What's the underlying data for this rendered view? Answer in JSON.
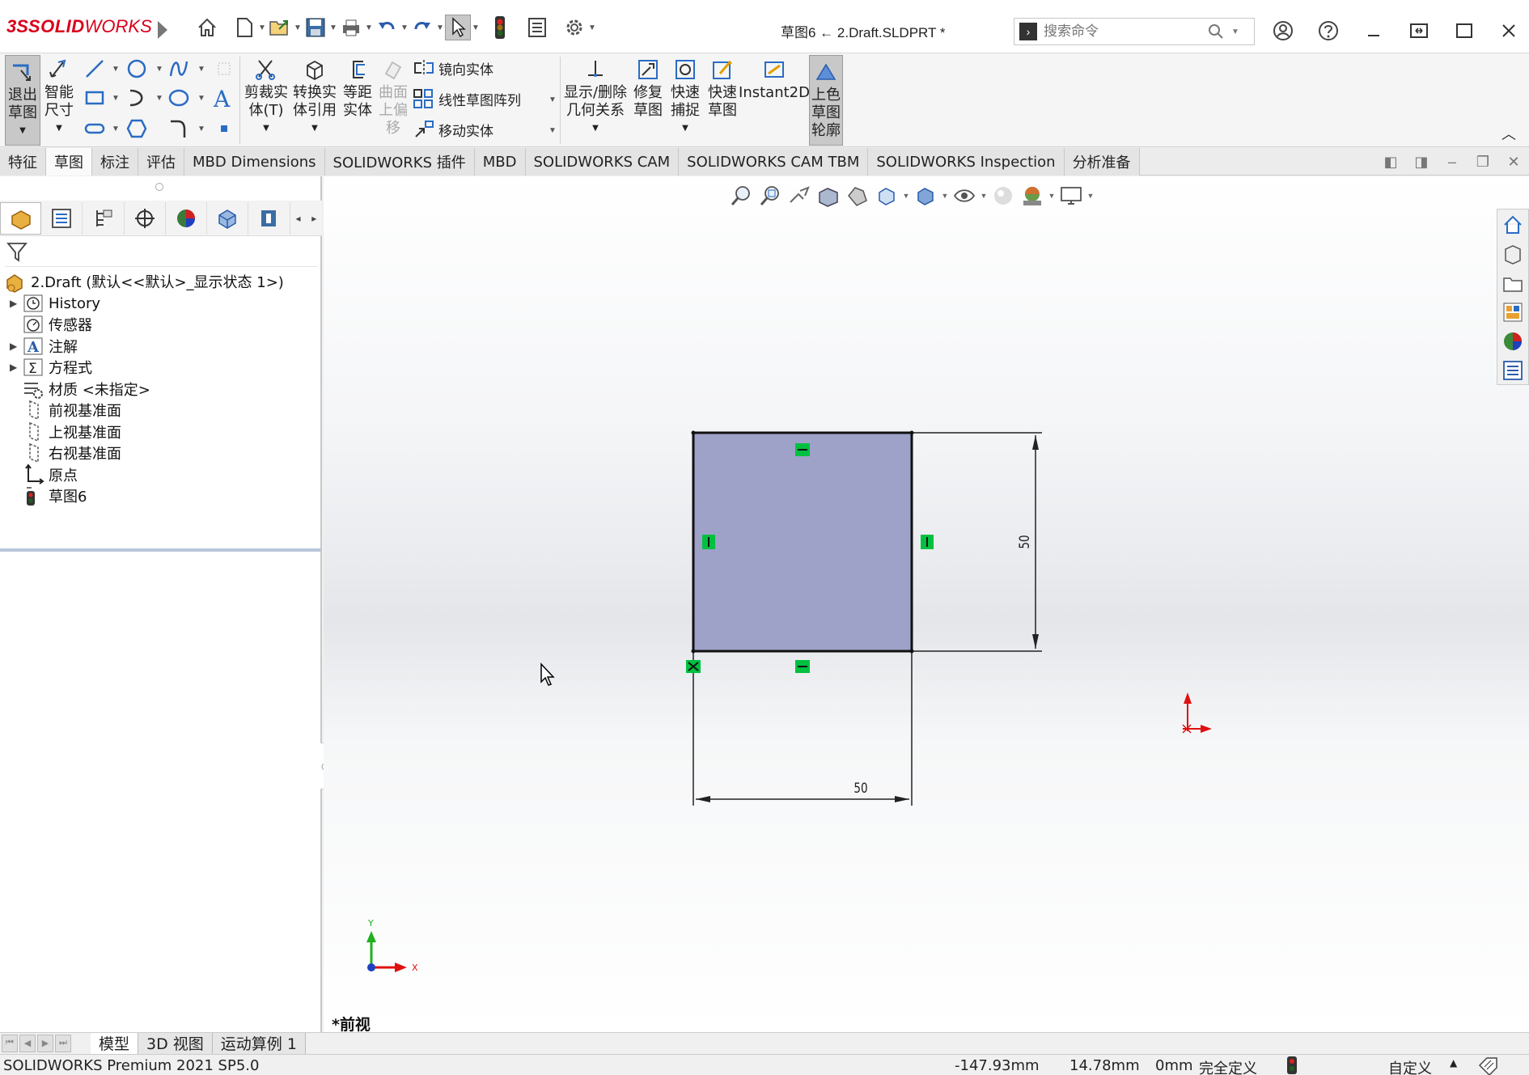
{
  "app": {
    "title": "草图6 ← 2.Draft.SLDPRT *",
    "logo_prefix": "3S",
    "logo_solid": "SOLID",
    "logo_works": "WORKS"
  },
  "search": {
    "placeholder": "搜索命令"
  },
  "ribbon": {
    "exit_sketch": [
      "退出",
      "草图"
    ],
    "smart_dim": [
      "智能",
      "尺寸"
    ],
    "trim": [
      "剪裁实",
      "体(T)"
    ],
    "convert": [
      "转换实",
      "体引用"
    ],
    "offset": [
      "等距",
      "实体"
    ],
    "surface_offset": [
      "曲面",
      "上偏",
      "移"
    ],
    "mirror": "镜向实体",
    "linear_pattern": "线性草图阵列",
    "move": "移动实体",
    "display_relations": [
      "显示/删除",
      "几何关系"
    ],
    "repair": [
      "修复",
      "草图"
    ],
    "quick_snaps": [
      "快速",
      "捕捉"
    ],
    "rapid_sketch": [
      "快速",
      "草图"
    ],
    "instant2d": "Instant2D",
    "shaded_contour": [
      "上色",
      "草图",
      "轮廓"
    ]
  },
  "tabs": [
    "特征",
    "草图",
    "标注",
    "评估",
    "MBD Dimensions",
    "SOLIDWORKS 插件",
    "MBD",
    "SOLIDWORKS CAM",
    "SOLIDWORKS CAM TBM",
    "SOLIDWORKS Inspection",
    "分析准备"
  ],
  "active_tab": "草图",
  "tree": {
    "root": "2.Draft  (默认<<默认>_显示状态 1>)",
    "items": [
      "History",
      "传感器",
      "注解",
      "方程式",
      "材质 <未指定>",
      "前视基准面",
      "上视基准面",
      "右视基准面",
      "原点",
      "草图6"
    ]
  },
  "sketch": {
    "dim_vertical": "50",
    "dim_horizontal": "50",
    "fill_color": "#9ea2c8",
    "relation_color": "#00c040",
    "axis_x_label": "X",
    "axis_y_label": "Y"
  },
  "view_name": "*前视",
  "bottom_tabs": [
    "模型",
    "3D 视图",
    "运动算例 1"
  ],
  "status": {
    "product": "SOLIDWORKS Premium 2021 SP5.0",
    "x": "-147.93mm",
    "y": "14.78mm",
    "z": "0mm",
    "state": "完全定义",
    "units": "自定义"
  },
  "colors": {
    "brand": "#d9001b",
    "tree_selection_bar": "#b8c6d8"
  }
}
